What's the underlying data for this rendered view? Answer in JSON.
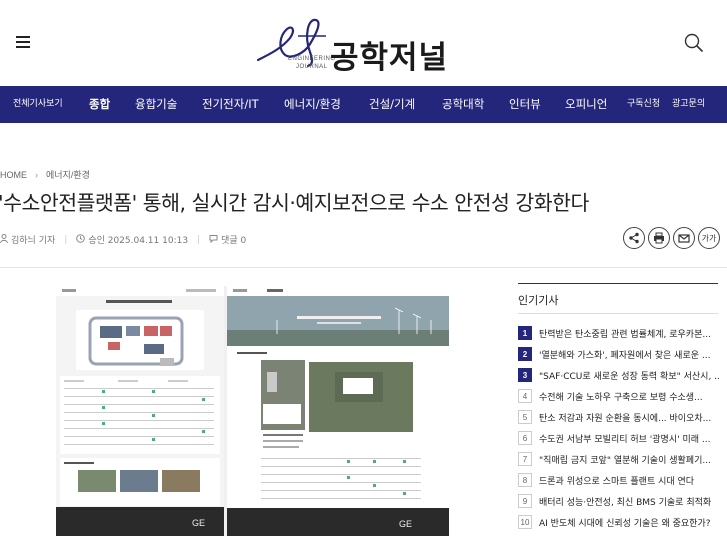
{
  "site": {
    "logo_text": "공학저널",
    "logo_sub_1": "ENGINEERING",
    "logo_sub_2": "JOURNAL",
    "brand_color": "#23267a"
  },
  "nav": {
    "items": [
      {
        "label": "전체기사보기"
      },
      {
        "label": "종합"
      },
      {
        "label": "융합기술"
      },
      {
        "label": "전기전자/IT"
      },
      {
        "label": "에너지/환경"
      },
      {
        "label": "건설/기계"
      },
      {
        "label": "공학대학"
      },
      {
        "label": "인터뷰"
      },
      {
        "label": "오피니언"
      },
      {
        "label": "구독신청"
      },
      {
        "label": "광고문의"
      }
    ]
  },
  "breadcrumb": {
    "home": "HOME",
    "section": "에너지/환경"
  },
  "article": {
    "title": "'수소안전플랫폼' 통해, 실시간 감시·예지보전으로 수소 안전성 강화한다",
    "author": "김하늬 기자",
    "approved": "승인 2025.04.11 10:13",
    "comments": "댓글 0",
    "font_size_btn": "가가"
  },
  "popular": {
    "heading": "인기기사",
    "items": [
      {
        "num": "1",
        "text": "탄력받은 탄소중립 관련 법률체계, 로우카본..."
      },
      {
        "num": "2",
        "text": "'열분해와 가스화', 폐자원에서 찾은 새로운 ..."
      },
      {
        "num": "3",
        "text": "\"SAF·CCU로 새로운 성장 동력 확보\" 서산시, ..."
      },
      {
        "num": "4",
        "text": "수전해 기술 노하우 구축으로 보령 수소생..."
      },
      {
        "num": "5",
        "text": "탄소 저감과 자원 순환을 동시에... 바이오차..."
      },
      {
        "num": "6",
        "text": "수도권 서남부 모빌리티 허브 '광명시' 미래 ..."
      },
      {
        "num": "7",
        "text": "\"직매립 금지 코앞\" 열분해 기술이 생활폐기..."
      },
      {
        "num": "8",
        "text": "드론과 위성으로 스마트 플랜트 시대 연다"
      },
      {
        "num": "9",
        "text": "배터리 성능·안전성, 최신 BMS 기술로 최적화"
      },
      {
        "num": "10",
        "text": "AI 반도체 시대에 신뢰성 기술은 왜 중요한가?"
      }
    ]
  }
}
